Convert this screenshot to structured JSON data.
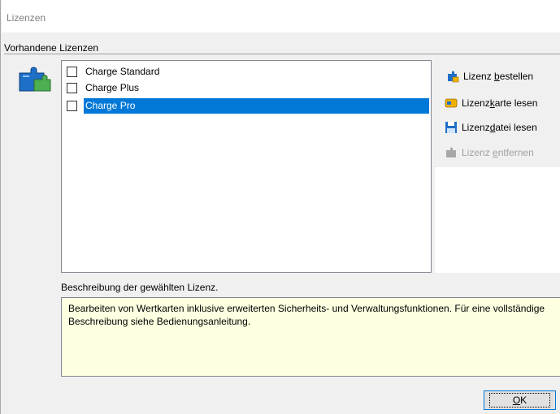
{
  "window": {
    "title": "Lizenzen"
  },
  "licenses": {
    "group_label": "Vorhandene Lizenzen",
    "items": [
      {
        "label": "Charge Standard",
        "checked": false,
        "selected": false
      },
      {
        "label": "Charge Plus",
        "checked": false,
        "selected": false
      },
      {
        "label": "Charge Pro",
        "checked": false,
        "selected": true
      }
    ]
  },
  "actions": {
    "order": {
      "pre": "Lizenz ",
      "key": "b",
      "post": "estellen",
      "icon": "license-order-icon",
      "enabled": true
    },
    "read_card": {
      "pre": "Lizenz",
      "key": "k",
      "post": "arte lesen",
      "icon": "license-card-icon",
      "enabled": true
    },
    "read_file": {
      "pre": "Lizenz",
      "key": "d",
      "post": "atei lesen",
      "icon": "floppy-disk-icon",
      "enabled": true
    },
    "remove": {
      "pre": "Lizenz ",
      "key": "e",
      "post": "ntfernen",
      "icon": "license-remove-icon",
      "enabled": false
    }
  },
  "description": {
    "label": "Beschreibung der gewählten Lizenz.",
    "text": "Bearbeiten von Wertkarten inklusive erweiterten Sicherheits- und Verwaltungsfunktionen. Für eine vollständige Beschreibung siehe Bedienungsanleitung."
  },
  "ok_button": {
    "key": "O",
    "post": "K"
  },
  "colors": {
    "selection": "#0078d7",
    "description_background": "#ffffe1",
    "icon_blue": "#1e6fc8",
    "icon_green": "#4caf50"
  }
}
